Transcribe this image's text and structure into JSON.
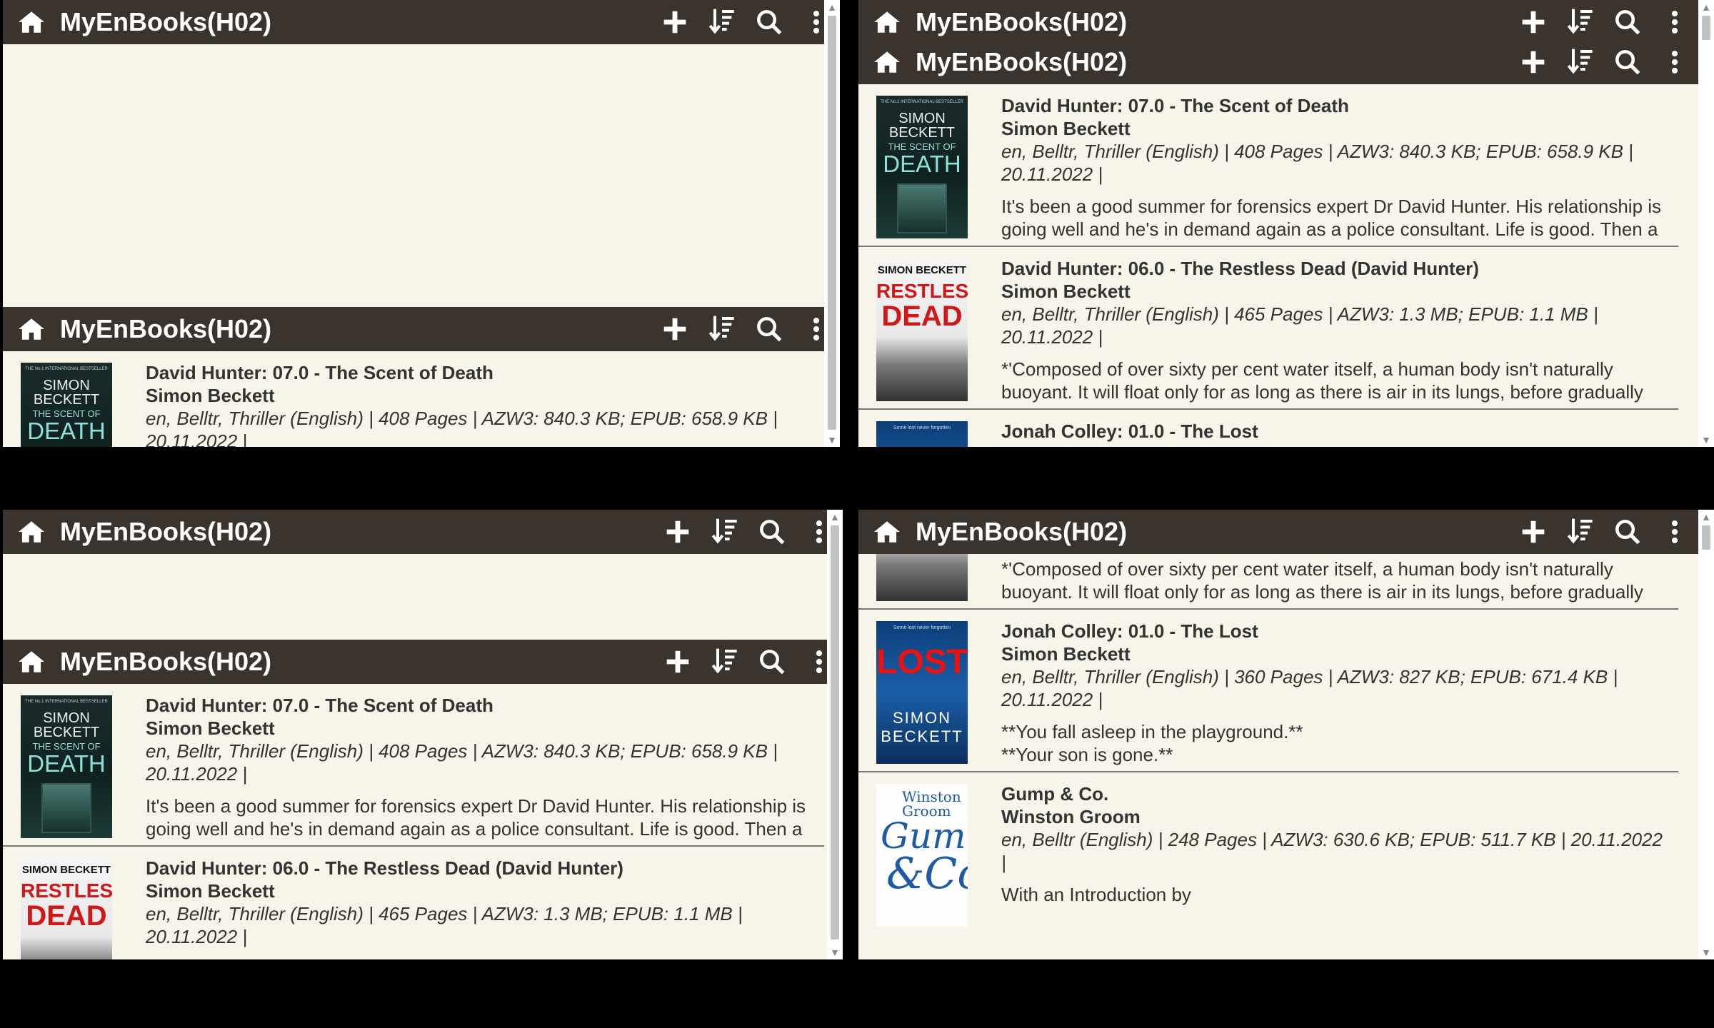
{
  "app": {
    "title": "MyEnBooks(H02)",
    "icons": {
      "home": "home-icon",
      "add": "plus-icon",
      "sort": "sort-icon",
      "search": "search-icon",
      "menu": "more-vertical-icon"
    },
    "colors": {
      "appbar": "#3b342e",
      "background": "#f7f4ea",
      "text": "#333333"
    }
  },
  "books": [
    {
      "title": "David Hunter: 07.0 - The Scent of Death",
      "author": "Simon Beckett",
      "meta": "en, Belltr, Thriller (English) | 408 Pages | AZW3: 840.3 KB; EPUB: 658.9 KB | 20.11.2022 |",
      "desc": "It's been a good summer for forensics expert Dr David Hunter. His relationship is going well and he's in demand again as a police consultant. Life is good. Then a",
      "cover": {
        "kicker": "THE No.1 INTERNATIONAL BESTSELLER",
        "author": "SIMON BECKETT",
        "sub": "THE SCENT OF",
        "main": "DEATH"
      }
    },
    {
      "title": "David Hunter: 06.0 - The Restless Dead (David Hunter)",
      "author": "Simon Beckett",
      "meta": "en, Belltr, Thriller (English) | 465 Pages | AZW3: 1.3 MB; EPUB: 1.1 MB | 20.11.2022 |",
      "desc": "*'Composed of over sixty per cent water itself, a human body isn't naturally buoyant. It will float only for as long as there is air in its lungs, before gradually",
      "cover": {
        "author": "SIMON BECKETT",
        "sub": "RESTLESS",
        "main": "DEAD"
      }
    },
    {
      "title": "Jonah Colley: 01.0 - The Lost",
      "author": "Simon Beckett",
      "meta": "en, Belltr, Thriller (English) | 360 Pages | AZW3: 827 KB; EPUB: 671.4 KB | 20.11.2022 |",
      "desc1": "**You fall asleep in the playground.**",
      "desc2": "**Your son is gone.**",
      "cover": {
        "kicker": "Some lost never forgotten",
        "main": "LOST",
        "author": "SIMON BECKETT"
      }
    },
    {
      "title": "Gump & Co.",
      "author": "Winston Groom",
      "meta": "en, Belltr (English) | 248 Pages | AZW3: 630.6 KB; EPUB: 511.7 KB | 20.11.2022 |",
      "desc": "With an Introduction by",
      "cover": {
        "author": "Winston Groom",
        "main": "Gump",
        "sub": "&Co."
      }
    }
  ]
}
